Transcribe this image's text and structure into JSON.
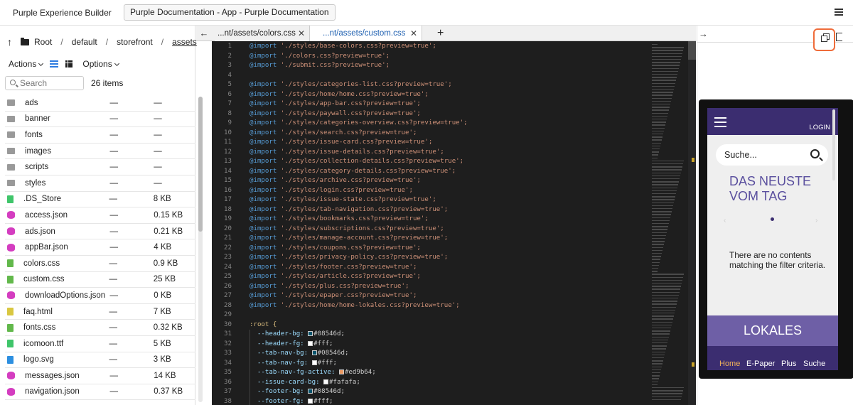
{
  "topbar": {
    "app_title": "Purple Experience Builder",
    "project_label": "Purple Documentation - App - Purple Documentation"
  },
  "breadcrumb": {
    "items": [
      "Root",
      "default",
      "storefront",
      "assets"
    ]
  },
  "toolbar": {
    "actions_label": "Actions",
    "options_label": "Options"
  },
  "search": {
    "placeholder": "Search"
  },
  "item_count": "26 items",
  "files": [
    {
      "name": "ads",
      "modified": "—",
      "size": "—",
      "type": "folder"
    },
    {
      "name": "banner",
      "modified": "—",
      "size": "—",
      "type": "folder"
    },
    {
      "name": "fonts",
      "modified": "—",
      "size": "—",
      "type": "folder"
    },
    {
      "name": "images",
      "modified": "—",
      "size": "—",
      "type": "folder"
    },
    {
      "name": "scripts",
      "modified": "—",
      "size": "—",
      "type": "folder"
    },
    {
      "name": "styles",
      "modified": "—",
      "size": "—",
      "type": "folder"
    },
    {
      "name": ".DS_Store",
      "modified": "—",
      "size": "8 KB",
      "type": "file-green"
    },
    {
      "name": "access.json",
      "modified": "—",
      "size": "0.15 KB",
      "type": "file-db"
    },
    {
      "name": "ads.json",
      "modified": "—",
      "size": "0.21 KB",
      "type": "file-db"
    },
    {
      "name": "appBar.json",
      "modified": "—",
      "size": "4 KB",
      "type": "file-db"
    },
    {
      "name": "colors.css",
      "modified": "—",
      "size": "0.9 KB",
      "type": "file-css"
    },
    {
      "name": "custom.css",
      "modified": "—",
      "size": "25 KB",
      "type": "file-css"
    },
    {
      "name": "downloadOptions.json",
      "modified": "—",
      "size": "0 KB",
      "type": "file-db"
    },
    {
      "name": "faq.html",
      "modified": "—",
      "size": "7 KB",
      "type": "file-yellow"
    },
    {
      "name": "fonts.css",
      "modified": "—",
      "size": "0.32 KB",
      "type": "file-css"
    },
    {
      "name": "icomoon.ttf",
      "modified": "—",
      "size": "5 KB",
      "type": "file-green"
    },
    {
      "name": "logo.svg",
      "modified": "—",
      "size": "3 KB",
      "type": "file-blue"
    },
    {
      "name": "messages.json",
      "modified": "—",
      "size": "14 KB",
      "type": "file-db"
    },
    {
      "name": "navigation.json",
      "modified": "—",
      "size": "0.37 KB",
      "type": "file-db"
    }
  ],
  "tabs": [
    {
      "label": "...nt/assets/colors.css",
      "close": "✕"
    },
    {
      "label": "...nt/assets/custom.css",
      "close": "✕"
    }
  ],
  "icons": {
    "back_arrow": "←",
    "forward_arrow": "→",
    "add_tab": "+",
    "up_arrow": "↑",
    "carousel_prev": "‹",
    "carousel_next": "›"
  },
  "code_lines": [
    {
      "n": 1,
      "kind": "import",
      "path": "'./styles/base-colors.css?preview=true';"
    },
    {
      "n": 2,
      "kind": "import",
      "path": "'./colors.css?preview=true';"
    },
    {
      "n": 3,
      "kind": "import",
      "path": "'./submit.css?preview=true';"
    },
    {
      "n": 4,
      "kind": "blank"
    },
    {
      "n": 5,
      "kind": "import",
      "path": "'./styles/categories-list.css?preview=true';"
    },
    {
      "n": 6,
      "kind": "import",
      "path": "'./styles/home/home.css?preview=true';"
    },
    {
      "n": 7,
      "kind": "import",
      "path": "'./styles/app-bar.css?preview=true';"
    },
    {
      "n": 8,
      "kind": "import",
      "path": "'./styles/paywall.css?preview=true';"
    },
    {
      "n": 9,
      "kind": "import",
      "path": "'./styles/categories-overview.css?preview=true';"
    },
    {
      "n": 10,
      "kind": "import",
      "path": "'./styles/search.css?preview=true';"
    },
    {
      "n": 11,
      "kind": "import",
      "path": "'./styles/issue-card.css?preview=true';"
    },
    {
      "n": 12,
      "kind": "import",
      "path": "'./styles/issue-details.css?preview=true';"
    },
    {
      "n": 13,
      "kind": "import",
      "path": "'./styles/collection-details.css?preview=true';"
    },
    {
      "n": 14,
      "kind": "import",
      "path": "'./styles/category-details.css?preview=true';"
    },
    {
      "n": 15,
      "kind": "import",
      "path": "'./styles/archive.css?preview=true';"
    },
    {
      "n": 16,
      "kind": "import",
      "path": "'./styles/login.css?preview=true';"
    },
    {
      "n": 17,
      "kind": "import",
      "path": "'./styles/issue-state.css?preview=true';"
    },
    {
      "n": 18,
      "kind": "import",
      "path": "'./styles/tab-navigation.css?preview=true';"
    },
    {
      "n": 19,
      "kind": "import",
      "path": "'./styles/bookmarks.css?preview=true';"
    },
    {
      "n": 20,
      "kind": "import",
      "path": "'./styles/subscriptions.css?preview=true';"
    },
    {
      "n": 21,
      "kind": "import",
      "path": "'./styles/manage-account.css?preview=true';"
    },
    {
      "n": 22,
      "kind": "import",
      "path": "'./styles/coupons.css?preview=true';"
    },
    {
      "n": 23,
      "kind": "import",
      "path": "'./styles/privacy-policy.css?preview=true';"
    },
    {
      "n": 24,
      "kind": "import",
      "path": "'./styles/footer.css?preview=true';"
    },
    {
      "n": 25,
      "kind": "import",
      "path": "'./styles/article.css?preview=true';"
    },
    {
      "n": 26,
      "kind": "import",
      "path": "'./styles/plus.css?preview=true';"
    },
    {
      "n": 27,
      "kind": "import",
      "path": "'./styles/epaper.css?preview=true';"
    },
    {
      "n": 28,
      "kind": "import",
      "path": "'./styles/home/home-lokales.css?preview=true';"
    },
    {
      "n": 29,
      "kind": "blank"
    },
    {
      "n": 30,
      "kind": "selector",
      "text": ":root {"
    },
    {
      "n": 31,
      "kind": "var",
      "prop": "--header-bg:",
      "color": "#08546d",
      "value": "#08546d;"
    },
    {
      "n": 32,
      "kind": "var",
      "prop": "--header-fg:",
      "color": "#ffffff",
      "value": "#fff;"
    },
    {
      "n": 33,
      "kind": "var",
      "prop": "--tab-nav-bg:",
      "color": "#08546d",
      "value": "#08546d;"
    },
    {
      "n": 34,
      "kind": "var",
      "prop": "--tab-nav-fg:",
      "color": "#ffffff",
      "value": "#fff;"
    },
    {
      "n": 35,
      "kind": "var",
      "prop": "--tab-nav-fg-active:",
      "color": "#ed9b64",
      "value": "#ed9b64;"
    },
    {
      "n": 36,
      "kind": "var",
      "prop": "--issue-card-bg:",
      "color": "#fafafa",
      "value": "#fafafa;"
    },
    {
      "n": 37,
      "kind": "var",
      "prop": "--footer-bg:",
      "color": "#08546d",
      "value": "#08546d;"
    },
    {
      "n": 38,
      "kind": "var",
      "prop": "--footer-fg:",
      "color": "#ffffff",
      "value": "#fff;"
    }
  ],
  "code_import_keyword": "@import",
  "preview": {
    "login": "LOGIN",
    "search_placeholder": "Suche...",
    "headline": "DAS NEUSTE VOM TAG",
    "empty_message": "There are no contents matching the filter criteria.",
    "section_title": "LOKALES",
    "footer_items": [
      "Home",
      "E-Paper",
      "Plus",
      "Suche"
    ],
    "colors": {
      "header": "#3b2d70",
      "accent": "#6e5fa6",
      "active_tab": "#f2b25a"
    }
  },
  "colors": {
    "editor_bg": "#1e1e1e",
    "highlight_border": "#ef6c3a",
    "active_tab_text": "#1d5fb0"
  }
}
